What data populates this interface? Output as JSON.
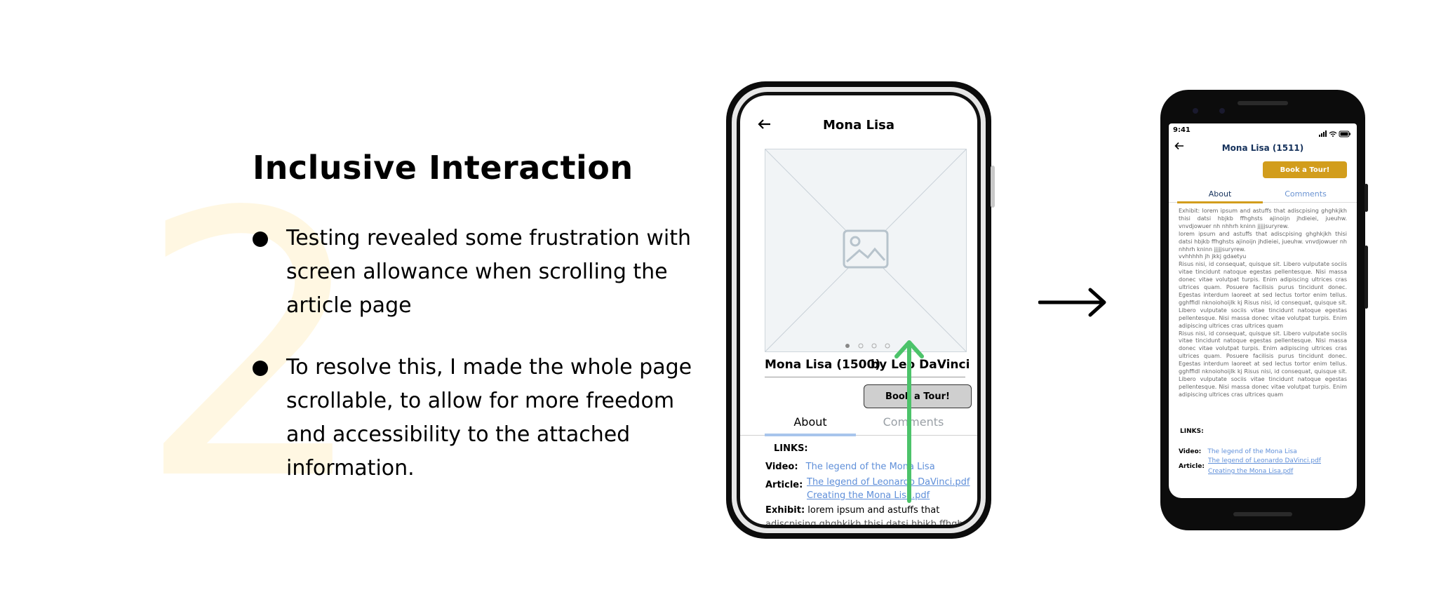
{
  "slide": {
    "number": "2",
    "title": "Inclusive Interaction",
    "bullets": [
      "Testing revealed some frustration with screen allowance when scrolling the article page",
      "To resolve this, I made the whole page scrollable, to allow for more freedom and accessibility to the attached information."
    ],
    "accent_color": "#fff7e2"
  },
  "old_screen": {
    "title": "Mona Lisa",
    "back_icon": "arrow-left-icon",
    "image_placeholder_icon": "image-placeholder-icon",
    "carousel_dots": 4,
    "caption": "Mona Lisa (1500)",
    "artist": "by Leo DaVinci",
    "book_button": "Book a Tour!",
    "tabs": [
      "About",
      "Comments"
    ],
    "links_heading": "LINKS:",
    "video_label": "Video:",
    "video_link": "The legend of the Mona Lisa",
    "article_label": "Article:",
    "article_links": [
      "The legend of Leonardo DaVinci.pdf",
      "Creating the Mona Lisa.pdf"
    ],
    "exhibit_label": "Exhibit:",
    "exhibit_text": "lorem ipsum and astuffs that",
    "exhibit_text_2": "adiscpising ghghkjkh thisi datsi hbjkb ffhghsts",
    "scroll_arrow_color": "#4cc36a"
  },
  "new_screen": {
    "status_time": "9:41",
    "title": "Mona Lisa (1511)",
    "book_button": "Book a Tour!",
    "tabs": [
      "About",
      "Comments"
    ],
    "body_paragraphs": [
      "Exhibit: lorem ipsum and astuffs that adiscpising ghghkjkh thisi datsi hbjkb ffhghsts ajinoijn jhdieiei, jueuhw. vnvdjowuer nh nhhrh kninn jjjjjsuryrew.",
      "lorem ipsum and astuffs that adiscpising ghghkjkh thisi datsi hbjkb ffhghsts ajinoijn jhdieiei, jueuhw. vnvdjowuer nh nhhrh kninn jjjjjsuryrew.",
      "vvhhhhh jh jkkj gdaetyu",
      "Risus nisi, id consequat, quisque sit. Libero vulputate sociis vitae tincidunt natoque egestas pellentesque. Nisi massa donec vitae volutpat turpis. Enim adipiscing ultrices cras ultrices quam. Posuere facilisis purus tincidunt donec. Egestas interdum laoreet at sed lectus tortor enim tellus. gghffidl nknoiohoijlk kj Risus nisi, id consequat, quisque sit. Libero vulputate sociis vitae tincidunt natoque egestas pellentesque. Nisi massa donec vitae volutpat turpis. Enim adipiscing ultrices cras ultrices quam",
      "Risus nisi, id consequat, quisque sit. Libero vulputate sociis vitae tincidunt natoque egestas pellentesque. Nisi massa donec vitae volutpat turpis. Enim adipiscing ultrices cras ultrices quam. Posuere facilisis purus tincidunt donec. Egestas interdum laoreet at sed lectus tortor enim tellus. gghffidl nknoiohoijlk kj Risus nisi, id consequat, quisque sit. Libero vulputate sociis vitae tincidunt natoque egestas pellentesque. Nisi massa donec vitae volutpat turpis. Enim adipiscing ultrices cras ultrices quam"
    ],
    "links_heading": "LINKS:",
    "video_label": "Video:",
    "video_link": "The legend of the Mona Lisa",
    "article_label": "Article:",
    "article_links": [
      "The legend of Leonardo DaVinci.pdf",
      "Creating the Mona Lisa.pdf"
    ],
    "accent_color": "#d29d1c"
  }
}
